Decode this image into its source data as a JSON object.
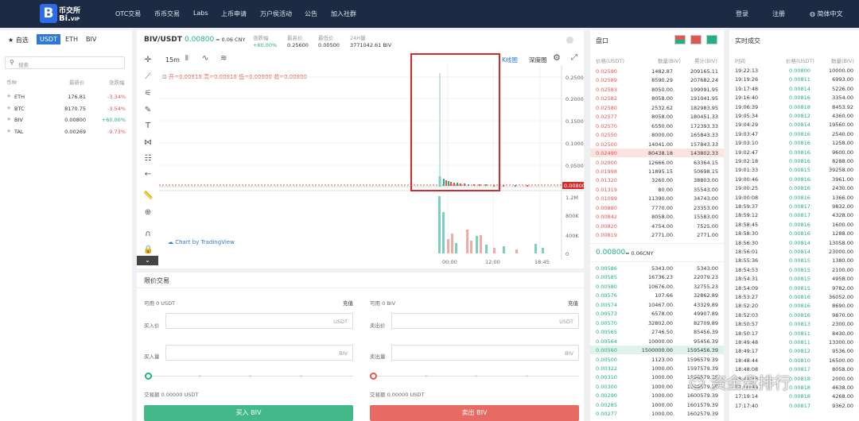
{
  "nav": {
    "logo_letter": "B",
    "brand_cn": "币交所",
    "brand_en": "Bi.",
    "brand_vip": "VIP",
    "links": [
      "OTC交易",
      "币币交易",
      "Labs",
      "上币申请",
      "万户侯活动",
      "公告",
      "加入社群"
    ],
    "login": "登录",
    "register": "注册",
    "language": "简体中文"
  },
  "markets": {
    "favorites": "自选",
    "tabs": [
      "USDT",
      "ETH",
      "BIV"
    ],
    "search_placeholder": "搜索",
    "headers": {
      "coin": "币种",
      "price": "最新价",
      "change": "涨跌幅"
    },
    "rows": [
      {
        "coin": "ETH",
        "price": "176.81",
        "change": "-3.34%",
        "up": false
      },
      {
        "coin": "BTC",
        "price": "8170.75",
        "change": "-3.54%",
        "up": false
      },
      {
        "coin": "BIV",
        "price": "0.00800",
        "change": "+60.00%",
        "up": true
      },
      {
        "coin": "TAL",
        "price": "0.00269",
        "change": "-9.73%",
        "up": false
      }
    ]
  },
  "ticker": {
    "pair": "BIV/USDT",
    "last": "0.00800",
    "cny": "≈ 0.06 CNY",
    "change_label": "涨跌幅",
    "change": "+60.00%",
    "high_label": "最高价",
    "high": "0.25600",
    "low_label": "最低价",
    "low": "0.00500",
    "vol_label": "24H量",
    "vol": "3771042.61 BIV"
  },
  "chart": {
    "interval": "15m",
    "kline_label": "K线图",
    "depth_label": "深度图",
    "ohlc": "开=0.00818  高=0.00818  低=0.00800  收=0.00800",
    "watermark": "Chart by TradingView",
    "price_ticks": [
      "0.25000",
      "0.20000",
      "0.15000",
      "0.10000",
      "0.05000"
    ],
    "price_last": "0.00800",
    "vol_ticks": [
      "1.2M",
      "800K",
      "400K",
      "0"
    ],
    "time_ticks": [
      "00:00",
      "12:00",
      "18:45"
    ]
  },
  "orderbook": {
    "title": "盘口",
    "headers": {
      "price": "价格(USDT)",
      "amount": "数量(BIV)",
      "total": "累计(BIV)"
    },
    "asks": [
      [
        "0.02590",
        "1482.87",
        "209165.11"
      ],
      [
        "0.02589",
        "8590.29",
        "207682.24"
      ],
      [
        "0.02583",
        "8050.00",
        "199091.95"
      ],
      [
        "0.02582",
        "8058.00",
        "191041.95"
      ],
      [
        "0.02580",
        "2532.62",
        "182983.95"
      ],
      [
        "0.02577",
        "8058.00",
        "180451.33"
      ],
      [
        "0.02570",
        "6550.00",
        "172393.33"
      ],
      [
        "0.02550",
        "8000.00",
        "165843.33"
      ],
      [
        "0.02500",
        "14041.00",
        "157843.33"
      ],
      [
        "0.02490",
        "80438.18",
        "143802.33"
      ],
      [
        "0.02000",
        "12666.00",
        "63364.15"
      ],
      [
        "0.01998",
        "11895.15",
        "50698.15"
      ],
      [
        "0.01320",
        "3260.00",
        "38803.00"
      ],
      [
        "0.01319",
        "80.00",
        "35543.00"
      ],
      [
        "0.01099",
        "11390.00",
        "34743.00"
      ],
      [
        "0.00880",
        "7770.00",
        "23353.00"
      ],
      [
        "0.00842",
        "8058.00",
        "15583.00"
      ],
      [
        "0.00820",
        "4754.00",
        "7525.00"
      ],
      [
        "0.00819",
        "2771.00",
        "2771.00"
      ]
    ],
    "mid_price": "0.00800",
    "mid_cny": "≈ 0.06CNY",
    "bids": [
      [
        "0.00586",
        "5343.00",
        "5343.00"
      ],
      [
        "0.00585",
        "16736.23",
        "22079.23"
      ],
      [
        "0.00580",
        "10676.00",
        "32755.23"
      ],
      [
        "0.00576",
        "107.66",
        "32862.89"
      ],
      [
        "0.00574",
        "10467.00",
        "43329.89"
      ],
      [
        "0.00573",
        "6578.00",
        "49907.89"
      ],
      [
        "0.00570",
        "32802.00",
        "82709.89"
      ],
      [
        "0.00565",
        "2746.50",
        "85456.39"
      ],
      [
        "0.00564",
        "10000.00",
        "95456.39"
      ],
      [
        "0.00560",
        "1500000.00",
        "1595456.39"
      ],
      [
        "0.00500",
        "1123.00",
        "1596579.39"
      ],
      [
        "0.00322",
        "1000.00",
        "1597579.39"
      ],
      [
        "0.00310",
        "1000.00",
        "1598579.39"
      ],
      [
        "0.00300",
        "1000.00",
        "1599579.39"
      ],
      [
        "0.00290",
        "1000.00",
        "1600579.39"
      ],
      [
        "0.00285",
        "1000.00",
        "1601579.39"
      ],
      [
        "0.00277",
        "1000.00",
        "1602579.39"
      ]
    ]
  },
  "trades": {
    "title": "实时成交",
    "headers": {
      "time": "时间",
      "price": "价格(USDT)",
      "amount": "数量(BIV)"
    },
    "rows": [
      [
        "19:22:13",
        "0.00800",
        "10000.00"
      ],
      [
        "19:19:26",
        "0.00811",
        "6993.00"
      ],
      [
        "19:17:48",
        "0.00814",
        "5226.00"
      ],
      [
        "19:16:40",
        "0.00816",
        "3354.00"
      ],
      [
        "19:06:39",
        "0.00818",
        "8453.92"
      ],
      [
        "19:05:34",
        "0.00812",
        "4360.00"
      ],
      [
        "19:04:29",
        "0.00814",
        "19560.00"
      ],
      [
        "19:03:47",
        "0.00816",
        "2540.00"
      ],
      [
        "19:03:10",
        "0.00816",
        "1258.00"
      ],
      [
        "19:02:47",
        "0.00816",
        "9600.00"
      ],
      [
        "19:02:18",
        "0.00816",
        "8288.00"
      ],
      [
        "19:01:33",
        "0.00815",
        "39258.00"
      ],
      [
        "19:00:46",
        "0.00816",
        "3961.00"
      ],
      [
        "19:00:25",
        "0.00816",
        "2430.00"
      ],
      [
        "19:00:08",
        "0.00816",
        "1366.00"
      ],
      [
        "18:59:37",
        "0.00817",
        "9832.00"
      ],
      [
        "18:59:12",
        "0.00817",
        "4328.00"
      ],
      [
        "18:58:45",
        "0.00816",
        "1600.00"
      ],
      [
        "18:58:30",
        "0.00816",
        "1288.00"
      ],
      [
        "18:56:30",
        "0.00814",
        "13058.00"
      ],
      [
        "18:56:01",
        "0.00814",
        "23000.00"
      ],
      [
        "18:55:36",
        "0.00815",
        "1380.00"
      ],
      [
        "18:54:53",
        "0.00815",
        "2100.00"
      ],
      [
        "18:54:31",
        "0.00815",
        "4958.00"
      ],
      [
        "18:54:09",
        "0.00815",
        "9782.00"
      ],
      [
        "18:53:27",
        "0.00816",
        "36052.00"
      ],
      [
        "18:52:20",
        "0.00816",
        "8690.00"
      ],
      [
        "18:52:03",
        "0.00816",
        "9870.00"
      ],
      [
        "18:50:57",
        "0.00813",
        "2300.00"
      ],
      [
        "18:50:17",
        "0.00811",
        "8430.00"
      ],
      [
        "18:49:48",
        "0.00811",
        "13300.00"
      ],
      [
        "18:49:17",
        "0.00812",
        "9536.00"
      ],
      [
        "18:48:44",
        "0.00810",
        "16500.00"
      ],
      [
        "18:48:08",
        "0.00817",
        "8058.00"
      ],
      [
        "18:47:33",
        "0.00818",
        "2000.00"
      ],
      [
        "17:50:39",
        "0.00818",
        "4638.00"
      ],
      [
        "17:19:14",
        "0.00818",
        "4268.00"
      ],
      [
        "17:17:40",
        "0.00817",
        "9362.00"
      ]
    ]
  },
  "limit": {
    "title": "限价交易",
    "buy": {
      "avail": "可用 0 USDT",
      "deposit": "充值",
      "price_label": "买入价",
      "price_unit": "USDT",
      "amount_label": "买入量",
      "amount_unit": "BIV",
      "turnover": "交易额 0.00000 USDT",
      "button": "买入 BIV"
    },
    "sell": {
      "avail": "可用 0 BIV",
      "deposit": "充值",
      "price_label": "卖出价",
      "price_unit": "USDT",
      "amount_label": "卖出量",
      "amount_unit": "BIV",
      "turnover": "交易额 0.00000 USDT",
      "button": "卖出 BIV"
    }
  },
  "watermark_text": "资金盘排行",
  "colors": {
    "up": "#1fb084",
    "down": "#e0574f",
    "nav": "#1d2a44",
    "accent": "#2e79d6",
    "highlight": "#d62a2a"
  }
}
